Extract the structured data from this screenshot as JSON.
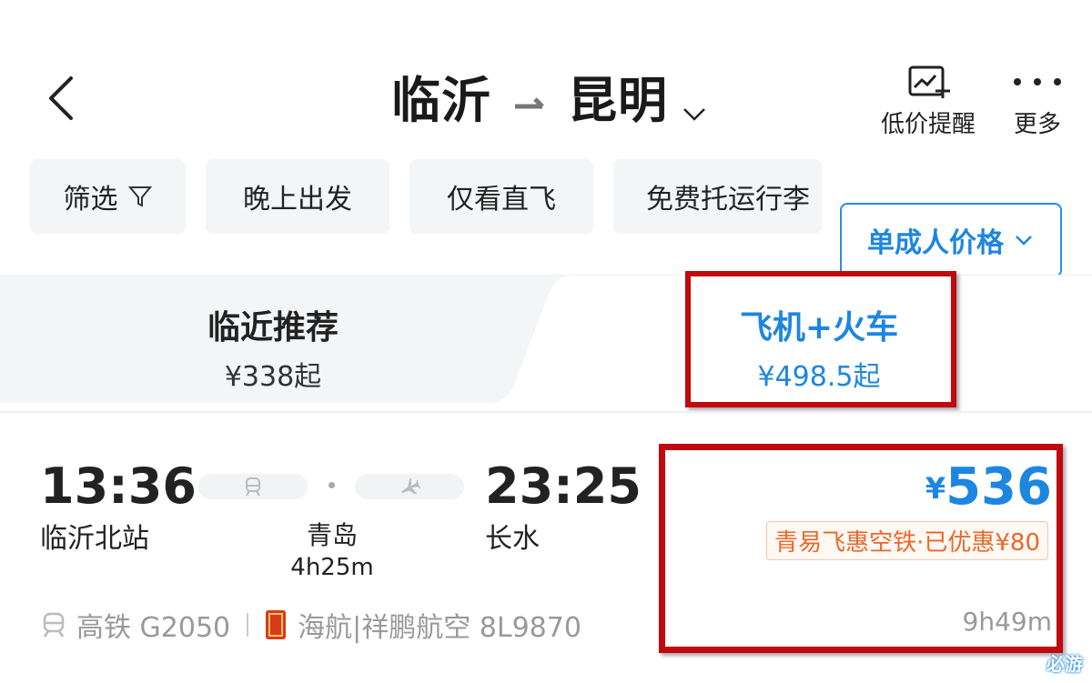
{
  "header": {
    "origin": "临沂",
    "destination": "昆明",
    "price_alert_label": "低价提醒",
    "more_label": "更多"
  },
  "filters": {
    "items": [
      "筛选",
      "晚上出发",
      "仅看直飞",
      "免费托运行李"
    ],
    "price_mode": "单成人价格"
  },
  "tabs": {
    "recommend": {
      "label": "临近推荐",
      "price": "¥338起"
    },
    "combo": {
      "label": "飞机+火车",
      "price": "¥498.5起"
    }
  },
  "itinerary": {
    "dep_time": "13:36",
    "dep_station": "临沂北站",
    "arr_time": "23:25",
    "arr_station": "长水",
    "transfer_city": "青岛",
    "transfer_duration": "4h25m",
    "train_label": "高铁 G2050",
    "flight_label": "海航|祥鹏航空 8L9870",
    "currency": "¥",
    "price": "536",
    "promo": "青易飞惠空铁·已优惠¥80",
    "total_duration": "9h49m"
  },
  "watermark": "必游",
  "colors": {
    "accent": "#1d86e0",
    "promo": "#e8692a",
    "highlight_box": "#c0080e",
    "chip_bg": "#f3f5f7"
  }
}
